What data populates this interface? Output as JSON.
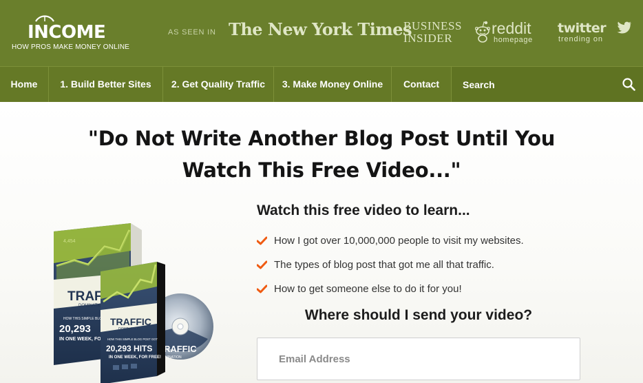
{
  "brand": {
    "logo_word": "INCOME",
    "tagline": "HOW PROS MAKE MONEY ONLINE"
  },
  "press": {
    "label": "AS SEEN IN",
    "nyt": "The New York Times",
    "business_insider": [
      "BUSINESS",
      "INSIDER"
    ],
    "reddit": {
      "name": "reddit",
      "sub": "homepage",
      "icon": "reddit-alien-icon"
    },
    "twitter": {
      "name": "twitter",
      "sub": "trending on",
      "icon": "twitter-bird-icon"
    }
  },
  "nav": {
    "items": [
      {
        "label": "Home"
      },
      {
        "label": "1. Build Better Sites"
      },
      {
        "label": "2. Get Quality Traffic"
      },
      {
        "label": "3. Make Money Online"
      },
      {
        "label": "Contact"
      }
    ],
    "search_placeholder": "Search",
    "search_icon": "search-icon"
  },
  "hero": {
    "headline": [
      "\"Do Not Write Another Blog Post Until You",
      "Watch This Free Video...\""
    ],
    "learn_title": "Watch this free video to learn...",
    "bullets": [
      "How I got over 10,000,000 people to visit my websites.",
      "The types of blog post that got me all that traffic.",
      "How to get someone else to do it for you!"
    ],
    "bullet_icon": "checkmark-icon",
    "send_title": "Where should I send your video?",
    "email_placeholder": "Email Address"
  },
  "product": {
    "title": "TRAFFIC",
    "subtitle": "DOMINATION",
    "box_blurb": "HOW THIS SIMPLE BLOG POST GOT",
    "box_number": "20,293 HITS",
    "box_rest": "IN ONE WEEK, FOR FREE!",
    "book_blurb": "HOW THIS SIMPLE BLOG POST GOT",
    "book_number": "20,293",
    "book_rest": "IN ONE WEEK, FOR",
    "book_chart_label": "4,454",
    "disc_title": "TRAFFIC",
    "disc_subtitle": "DOMINATION"
  },
  "colors": {
    "header_green": "#6a7f2c",
    "nav_green": "#657926",
    "checkmark_orange": "#ef5b12",
    "product_navy": "#2a3f5f",
    "product_lime": "#9ebf3a"
  }
}
